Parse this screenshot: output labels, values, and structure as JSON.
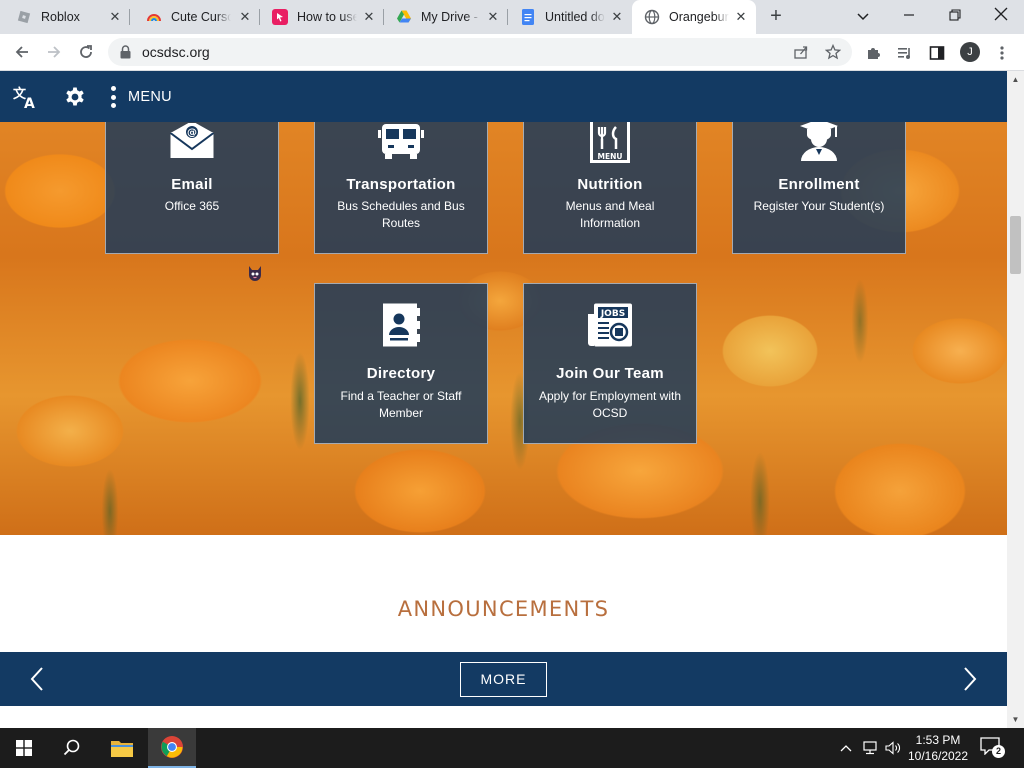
{
  "browser": {
    "tabs": [
      {
        "title": "Roblox",
        "icon": "roblox-icon"
      },
      {
        "title": "Cute Cursors",
        "icon": "rainbow-icon"
      },
      {
        "title": "How to use",
        "icon": "cursor-app-icon"
      },
      {
        "title": "My Drive -",
        "icon": "google-drive-icon"
      },
      {
        "title": "Untitled do",
        "icon": "google-docs-icon"
      },
      {
        "title": "Orangebur",
        "icon": "globe-icon",
        "active": true
      }
    ],
    "url": "ocsdsc.org",
    "profile_initial": "J"
  },
  "site": {
    "nav": {
      "menu_label": "MENU"
    },
    "cards": [
      {
        "title": "Email",
        "subtitle": "Office 365",
        "icon": "envelope-at-icon"
      },
      {
        "title": "Transportation",
        "subtitle": "Bus Schedules and Bus Routes",
        "icon": "school-bus-icon"
      },
      {
        "title": "Nutrition",
        "subtitle": "Menus and Meal Information",
        "icon": "menu-card-icon"
      },
      {
        "title": "Enrollment",
        "subtitle": "Register Your Student(s)",
        "icon": "graduate-icon"
      },
      {
        "title": "Directory",
        "subtitle": "Find a Teacher or Staff Member",
        "icon": "contact-book-icon"
      },
      {
        "title": "Join Our Team",
        "subtitle": "Apply for Employment with OCSD",
        "icon": "jobs-newspaper-icon"
      }
    ],
    "announcements": {
      "heading": "ANNOUNCEMENTS",
      "more_label": "MORE"
    }
  },
  "taskbar": {
    "time": "1:53 PM",
    "date": "10/16/2022",
    "notification_count": "2"
  },
  "colors": {
    "nav_blue": "#133a63",
    "card_blue": "#16375c",
    "heading_brown": "#b86f3e"
  }
}
